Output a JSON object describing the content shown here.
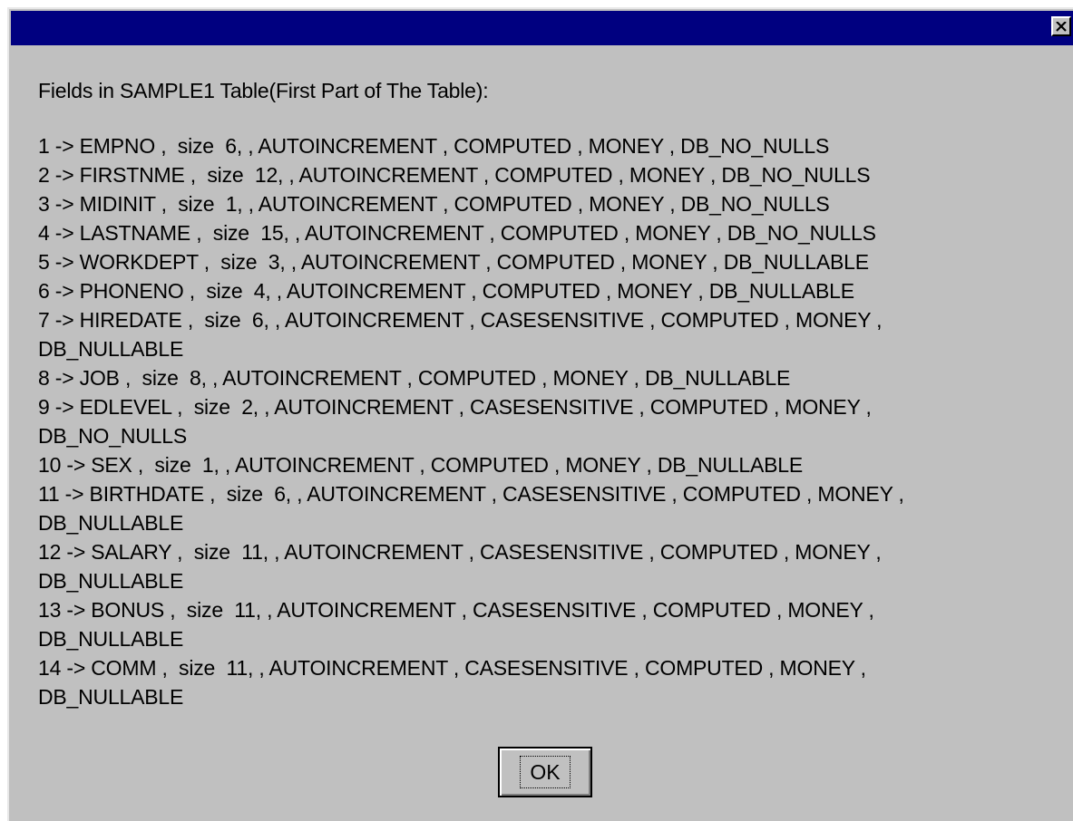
{
  "dialog": {
    "title": "",
    "heading": "Fields in SAMPLE1 Table(First Part of The Table):",
    "lines": [
      "1 -> EMPNO ,  size  6, , AUTOINCREMENT , COMPUTED , MONEY , DB_NO_NULLS",
      "2 -> FIRSTNME ,  size  12, , AUTOINCREMENT , COMPUTED , MONEY , DB_NO_NULLS",
      "3 -> MIDINIT ,  size  1, , AUTOINCREMENT , COMPUTED , MONEY , DB_NO_NULLS",
      "4 -> LASTNAME ,  size  15, , AUTOINCREMENT , COMPUTED , MONEY , DB_NO_NULLS",
      "5 -> WORKDEPT ,  size  3, , AUTOINCREMENT , COMPUTED , MONEY , DB_NULLABLE",
      "6 -> PHONENO ,  size  4, , AUTOINCREMENT , COMPUTED , MONEY , DB_NULLABLE",
      "7 -> HIREDATE ,  size  6, , AUTOINCREMENT , CASESENSITIVE , COMPUTED , MONEY ,",
      "DB_NULLABLE",
      "8 -> JOB ,  size  8, , AUTOINCREMENT , COMPUTED , MONEY , DB_NULLABLE",
      "9 -> EDLEVEL ,  size  2, , AUTOINCREMENT , CASESENSITIVE , COMPUTED , MONEY ,",
      "DB_NO_NULLS",
      "10 -> SEX ,  size  1, , AUTOINCREMENT , COMPUTED , MONEY , DB_NULLABLE",
      "11 -> BIRTHDATE ,  size  6, , AUTOINCREMENT , CASESENSITIVE , COMPUTED , MONEY ,",
      "DB_NULLABLE",
      "12 -> SALARY ,  size  11, , AUTOINCREMENT , CASESENSITIVE , COMPUTED , MONEY ,",
      "DB_NULLABLE",
      "13 -> BONUS ,  size  11, , AUTOINCREMENT , CASESENSITIVE , COMPUTED , MONEY ,",
      "DB_NULLABLE",
      "14 -> COMM ,  size  11, , AUTOINCREMENT , CASESENSITIVE , COMPUTED , MONEY ,",
      "DB_NULLABLE"
    ],
    "ok_label": "OK",
    "close_icon": "close-icon"
  },
  "colors": {
    "titlebar": "#000080",
    "face": "#c0c0c0",
    "text": "#000000"
  }
}
